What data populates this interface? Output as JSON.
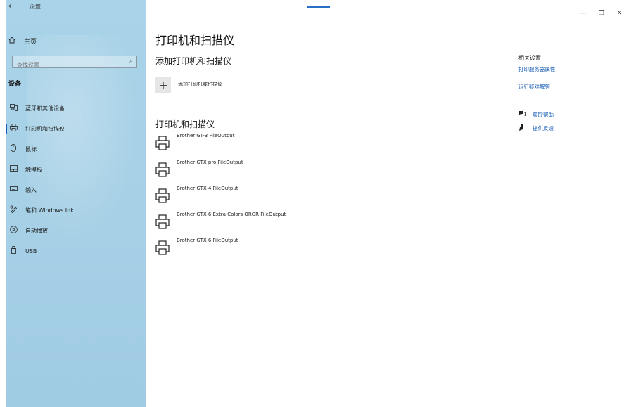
{
  "window": {
    "back_glyph": "←",
    "title": "设置",
    "controls": {
      "minimize": "—",
      "restore": "❐",
      "close": "✕"
    }
  },
  "sidebar": {
    "home_label": "主页",
    "search_placeholder": "查找设置",
    "section_title": "设备",
    "items": [
      {
        "label": "蓝牙和其他设备",
        "icon": "bluetooth-devices-icon",
        "active": false
      },
      {
        "label": "打印机和扫描仪",
        "icon": "printer-icon",
        "active": true
      },
      {
        "label": "鼠标",
        "icon": "mouse-icon",
        "active": false
      },
      {
        "label": "触摸板",
        "icon": "touchpad-icon",
        "active": false
      },
      {
        "label": "输入",
        "icon": "keyboard-icon",
        "active": false
      },
      {
        "label": "笔和 Windows Ink",
        "icon": "pen-icon",
        "active": false
      },
      {
        "label": "自动播放",
        "icon": "autoplay-icon",
        "active": false
      },
      {
        "label": "USB",
        "icon": "usb-icon",
        "active": false
      }
    ]
  },
  "main": {
    "title": "打印机和扫描仪",
    "add_section_title": "添加打印机和扫描仪",
    "add_button_glyph": "+",
    "add_button_label": "添加打印机或扫描仪",
    "list_title": "打印机和扫描仪",
    "printers": [
      "Brother GT-3 FileOutput",
      "Brother GTX pro FileOutput",
      "Brother GTX-4 FileOutput",
      "Brother GTX-6 Extra Colors ORGR FileOutput",
      "Brother GTX-6 FileOutput"
    ]
  },
  "related": {
    "title": "相关设置",
    "links": [
      "打印服务器属性",
      "运行疑难解答"
    ],
    "help": [
      {
        "label": "获取帮助",
        "icon": "help-chat-icon"
      },
      {
        "label": "提供反馈",
        "icon": "feedback-icon"
      }
    ]
  },
  "colors": {
    "sidebar_bg": "#a9d3e8",
    "accent": "#1a5fb4"
  }
}
